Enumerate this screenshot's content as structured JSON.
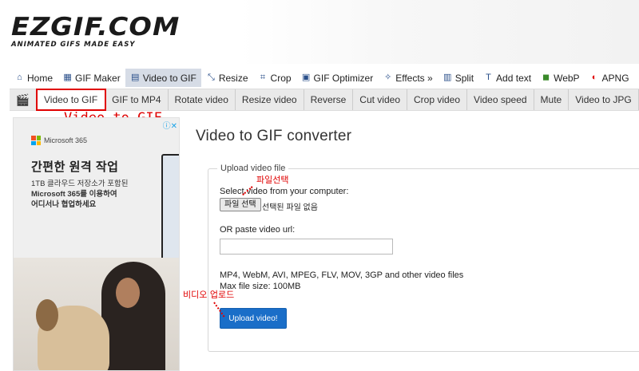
{
  "logo": {
    "main": "EZGIF.COM",
    "tagline": "ANIMATED GIFS MADE EASY"
  },
  "main_nav": [
    {
      "label": "Home",
      "icon": "home-icon",
      "glyph": "⌂",
      "active": false
    },
    {
      "label": "GIF Maker",
      "icon": "gif-maker-icon",
      "glyph": "▦",
      "active": false
    },
    {
      "label": "Video to GIF",
      "icon": "video-icon",
      "glyph": "▤",
      "active": true
    },
    {
      "label": "Resize",
      "icon": "resize-icon",
      "glyph": "⤡",
      "active": false
    },
    {
      "label": "Crop",
      "icon": "crop-icon",
      "glyph": "⌗",
      "active": false
    },
    {
      "label": "GIF Optimizer",
      "icon": "optimizer-icon",
      "glyph": "▣",
      "active": false
    },
    {
      "label": "Effects »",
      "icon": "effects-icon",
      "glyph": "✧",
      "active": false
    },
    {
      "label": "Split",
      "icon": "split-icon",
      "glyph": "▥",
      "active": false
    },
    {
      "label": "Add text",
      "icon": "add-text-icon",
      "glyph": "T",
      "active": false
    },
    {
      "label": "WebP",
      "icon": "webp-icon",
      "glyph": "◼",
      "active": false
    },
    {
      "label": "APNG",
      "icon": "apng-icon",
      "glyph": "◐",
      "active": false
    }
  ],
  "sub_nav": [
    {
      "label": "Video to GIF",
      "active": true
    },
    {
      "label": "GIF to MP4",
      "active": false
    },
    {
      "label": "Rotate video",
      "active": false
    },
    {
      "label": "Resize video",
      "active": false
    },
    {
      "label": "Reverse",
      "active": false
    },
    {
      "label": "Cut video",
      "active": false
    },
    {
      "label": "Crop video",
      "active": false
    },
    {
      "label": "Video speed",
      "active": false
    },
    {
      "label": "Mute",
      "active": false
    },
    {
      "label": "Video to JPG",
      "active": false
    }
  ],
  "annotations": {
    "video_to_gif": "Video to GIF",
    "file_select": "파일선택",
    "video_upload": "비디오 업로드"
  },
  "ad": {
    "brand": "Microsoft 365",
    "headline": "간편한 원격 작업",
    "body_line1": "1TB 클라우드 저장소가 포함된",
    "body_line2": "Microsoft 365를 이용하여",
    "body_line3": "어디서나 협업하세요"
  },
  "main": {
    "title": "Video to GIF converter",
    "legend": "Upload video file",
    "select_label": "Select video from your computer:",
    "file_button": "파일 선택",
    "file_status": "선택된 파일 없음",
    "url_label": "OR paste video url:",
    "url_value": "",
    "formats": "MP4, WebM, AVI, MPEG, FLV, MOV, 3GP and other video files",
    "max_size": "Max file size: 100MB",
    "upload_button": "Upload video!"
  },
  "colors": {
    "highlight": "#e00000",
    "upload_button": "#1a6ec8",
    "active_nav": "#d6dce6"
  }
}
